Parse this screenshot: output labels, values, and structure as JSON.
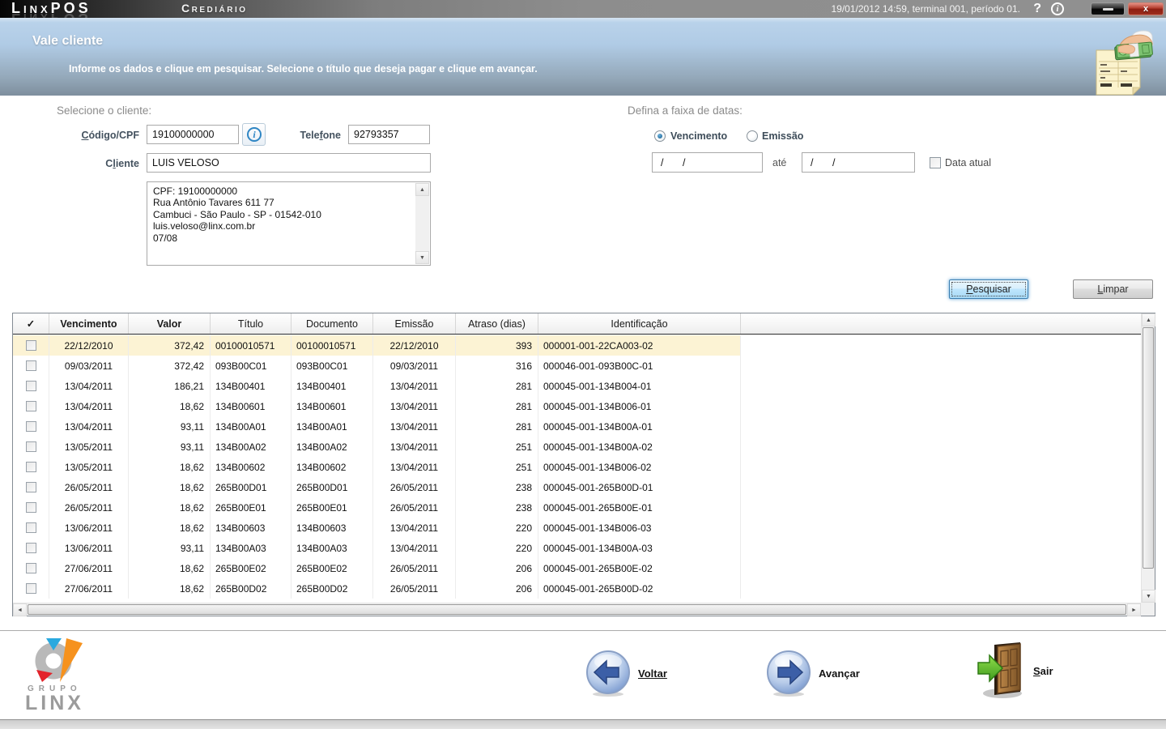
{
  "titlebar": {
    "brand": "LinxPOS",
    "module": "Crediário",
    "status": "19/01/2012 14:59, terminal 001, período 01.",
    "help_glyph": "?",
    "info_glyph": "i",
    "close_glyph": "x"
  },
  "header": {
    "title": "Vale cliente",
    "instruction": "Informe os dados e clique em pesquisar. Selecione o título que deseja pagar e clique em avançar."
  },
  "client": {
    "heading": "Selecione o cliente:",
    "codigo_label": {
      "pre": "",
      "key": "C",
      "post": "ódigo/CPF"
    },
    "codigo_value": "19100000000",
    "telefone_label": {
      "pre": "Tele",
      "key": "f",
      "post": "one"
    },
    "telefone_value": "92793357",
    "cliente_label": {
      "pre": "C",
      "key": "l",
      "post": "iente"
    },
    "cliente_value": "LUIS VELOSO",
    "details": "CPF: 19100000000\nRua Antônio Tavares 611 77\nCambuci - São Paulo - SP - 01542-010\nluis.veloso@linx.com.br\n07/08"
  },
  "dates": {
    "heading": "Defina a faixa de datas:",
    "vencimento_label": "Vencimento",
    "emissao_label": "Emissão",
    "from_value": "/ /",
    "ate_label": "até",
    "to_value": "/ /",
    "data_atual_label": "Data atual"
  },
  "actions": {
    "pesquisar": {
      "pre": "",
      "key": "P",
      "post": "esquisar"
    },
    "limpar": {
      "pre": "",
      "key": "L",
      "post": "impar"
    }
  },
  "table": {
    "selected_row_index": 0,
    "headers": {
      "check": "✓",
      "vencimento": "Vencimento",
      "valor": "Valor",
      "titulo": "Título",
      "documento": "Documento",
      "emissao": "Emissão",
      "atraso": "Atraso (dias)",
      "identificacao": "Identificação"
    },
    "rows": [
      {
        "vencimento": "22/12/2010",
        "valor": "372,42",
        "titulo": "00100010571",
        "documento": "00100010571",
        "emissao": "22/12/2010",
        "atraso": "393",
        "identificacao": "000001-001-22CA003-02"
      },
      {
        "vencimento": "09/03/2011",
        "valor": "372,42",
        "titulo": "093B00C01",
        "documento": "093B00C01",
        "emissao": "09/03/2011",
        "atraso": "316",
        "identificacao": "000046-001-093B00C-01"
      },
      {
        "vencimento": "13/04/2011",
        "valor": "186,21",
        "titulo": "134B00401",
        "documento": "134B00401",
        "emissao": "13/04/2011",
        "atraso": "281",
        "identificacao": "000045-001-134B004-01"
      },
      {
        "vencimento": "13/04/2011",
        "valor": "18,62",
        "titulo": "134B00601",
        "documento": "134B00601",
        "emissao": "13/04/2011",
        "atraso": "281",
        "identificacao": "000045-001-134B006-01"
      },
      {
        "vencimento": "13/04/2011",
        "valor": "93,11",
        "titulo": "134B00A01",
        "documento": "134B00A01",
        "emissao": "13/04/2011",
        "atraso": "281",
        "identificacao": "000045-001-134B00A-01"
      },
      {
        "vencimento": "13/05/2011",
        "valor": "93,11",
        "titulo": "134B00A02",
        "documento": "134B00A02",
        "emissao": "13/04/2011",
        "atraso": "251",
        "identificacao": "000045-001-134B00A-02"
      },
      {
        "vencimento": "13/05/2011",
        "valor": "18,62",
        "titulo": "134B00602",
        "documento": "134B00602",
        "emissao": "13/04/2011",
        "atraso": "251",
        "identificacao": "000045-001-134B006-02"
      },
      {
        "vencimento": "26/05/2011",
        "valor": "18,62",
        "titulo": "265B00D01",
        "documento": "265B00D01",
        "emissao": "26/05/2011",
        "atraso": "238",
        "identificacao": "000045-001-265B00D-01"
      },
      {
        "vencimento": "26/05/2011",
        "valor": "18,62",
        "titulo": "265B00E01",
        "documento": "265B00E01",
        "emissao": "26/05/2011",
        "atraso": "238",
        "identificacao": "000045-001-265B00E-01"
      },
      {
        "vencimento": "13/06/2011",
        "valor": "18,62",
        "titulo": "134B00603",
        "documento": "134B00603",
        "emissao": "13/04/2011",
        "atraso": "220",
        "identificacao": "000045-001-134B006-03"
      },
      {
        "vencimento": "13/06/2011",
        "valor": "93,11",
        "titulo": "134B00A03",
        "documento": "134B00A03",
        "emissao": "13/04/2011",
        "atraso": "220",
        "identificacao": "000045-001-134B00A-03"
      },
      {
        "vencimento": "27/06/2011",
        "valor": "18,62",
        "titulo": "265B00E02",
        "documento": "265B00E02",
        "emissao": "26/05/2011",
        "atraso": "206",
        "identificacao": "000045-001-265B00E-02"
      },
      {
        "vencimento": "27/06/2011",
        "valor": "18,62",
        "titulo": "265B00D02",
        "documento": "265B00D02",
        "emissao": "26/05/2011",
        "atraso": "206",
        "identificacao": "000045-001-265B00D-02"
      }
    ]
  },
  "footer": {
    "logo_grupo": "GRUPO",
    "logo_linx": "LINX",
    "voltar_label": "Voltar",
    "avancar_label": "Avançar",
    "sair_label": {
      "pre": "",
      "key": "S",
      "post": "air"
    }
  },
  "colors": {
    "header_blue_top": "#b9d2ea",
    "header_blue_bottom": "#7e8e9d",
    "row_highlight": "#fcf3d4",
    "focus_button_border": "#3c7fb1"
  }
}
